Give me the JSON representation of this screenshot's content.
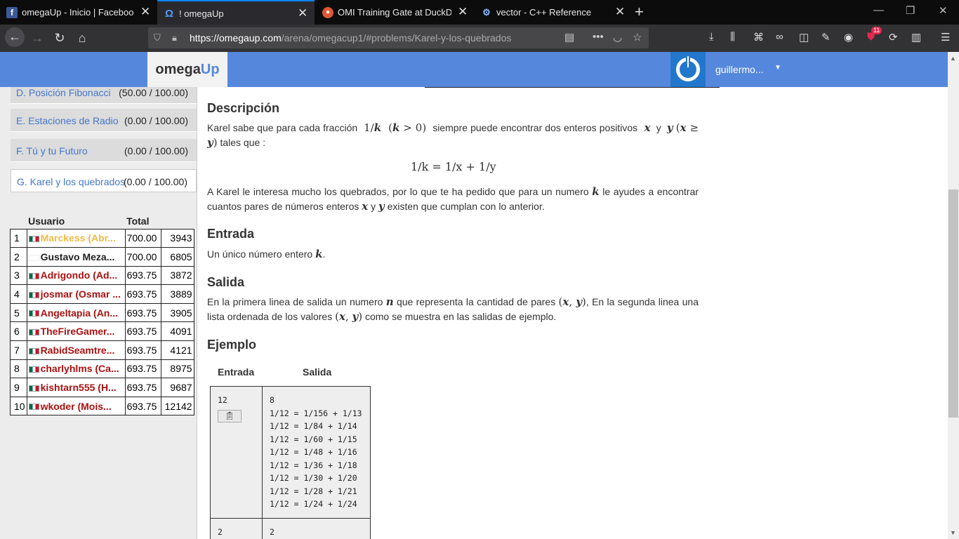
{
  "browser": {
    "tabs": [
      {
        "title": "omegaUp - Inicio | Facebook",
        "icon": "facebook-icon"
      },
      {
        "title": "! omegaUp",
        "icon": "omega-icon"
      },
      {
        "title": "OMI Training Gate at DuckDuck",
        "icon": "duckduckgo-icon"
      },
      {
        "title": "vector - C++ Reference",
        "icon": "cplusplus-icon"
      }
    ],
    "url_host": "https://omegaup.com",
    "url_path": "/arena/omegacup1/#problems/Karel-y-los-quebrados",
    "notification_count": "11"
  },
  "header": {
    "logo_a": "omega",
    "logo_b": "Up",
    "username": "guillermo..."
  },
  "problems": [
    {
      "name": "D. Posición Fibonacci",
      "score": "(50.00 / 100.00)"
    },
    {
      "name": "E. Estaciones de Radio",
      "score": "(0.00 / 100.00)"
    },
    {
      "name": "F. Tú y tu Futuro",
      "score": "(0.00 / 100.00)"
    },
    {
      "name": "G. Karel y los quebrados",
      "score": "(0.00 / 100.00)"
    }
  ],
  "scoreboard": {
    "headers": {
      "user": "Usuario",
      "total": "Total"
    },
    "rows": [
      {
        "rank": "1",
        "user": "Marckess (Abr...",
        "total": "700.00",
        "penalty": "3943"
      },
      {
        "rank": "2",
        "user": "Gustavo Meza...",
        "total": "700.00",
        "penalty": "6805"
      },
      {
        "rank": "3",
        "user": "Adrigondo (Ad...",
        "total": "693.75",
        "penalty": "3872"
      },
      {
        "rank": "4",
        "user": "josmar (Osmar ...",
        "total": "693.75",
        "penalty": "3889"
      },
      {
        "rank": "5",
        "user": "Angeltapia (An...",
        "total": "693.75",
        "penalty": "3905"
      },
      {
        "rank": "6",
        "user": "TheFireGamer...",
        "total": "693.75",
        "penalty": "4091"
      },
      {
        "rank": "7",
        "user": "RabidSeamtre...",
        "total": "693.75",
        "penalty": "4121"
      },
      {
        "rank": "8",
        "user": "charlyhlms (Ca...",
        "total": "693.75",
        "penalty": "8975"
      },
      {
        "rank": "9",
        "user": "kishtarn555 (H...",
        "total": "693.75",
        "penalty": "9687"
      },
      {
        "rank": "10",
        "user": "wkoder (Mois...",
        "total": "693.75",
        "penalty": "12142"
      }
    ]
  },
  "statement": {
    "desc_title": "Descripción",
    "desc_p1_a": "Karel sabe que para cada fracción",
    "desc_p1_b": "siempre puede encontrar dos enteros positivos",
    "desc_p1_c": "tales que :",
    "formula": "1/k = 1/x + 1/y",
    "desc_p2_a": "A Karel le interesa mucho los quebrados, por lo que te ha pedido que para un numero",
    "desc_p2_b": "le ayudes a encontrar cuantos pares de números enteros",
    "desc_p2_c": "existen que cumplan con lo anterior.",
    "input_title": "Entrada",
    "input_text": "Un único número entero",
    "output_title": "Salida",
    "output_a": "En la primera linea de salida un numero",
    "output_b": "que representa la cantidad de pares",
    "output_c": ", En la segunda linea una lista ordenada de los valores",
    "output_d": "como se muestra en las salidas de ejemplo.",
    "example_title": "Ejemplo",
    "example_in_header": "Entrada",
    "example_out_header": "Salida",
    "example1_in": "12",
    "example1_out": "8\n1/12 = 1/156 + 1/13\n1/12 = 1/84 + 1/14\n1/12 = 1/60 + 1/15\n1/12 = 1/48 + 1/16\n1/12 = 1/36 + 1/18\n1/12 = 1/30 + 1/20\n1/12 = 1/28 + 1/21\n1/12 = 1/24 + 1/24",
    "example2_in": "2",
    "example2_out": "2"
  }
}
